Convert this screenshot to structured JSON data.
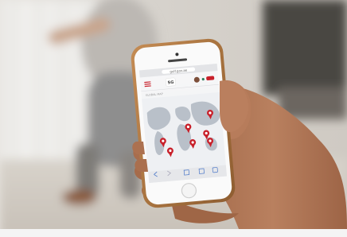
{
  "phone": {
    "url": "gulf.gov.ae",
    "app_logo_text": "SG",
    "section_label": "GLOBAL MAP",
    "colors": {
      "accent": "#c8202a",
      "map_land": "#b9c0c9",
      "map_sea": "#eef0f3",
      "phone_body": "#b07a45"
    },
    "icons": [
      "menu-icon",
      "avatar",
      "location-pin-icon",
      "home-button"
    ]
  }
}
